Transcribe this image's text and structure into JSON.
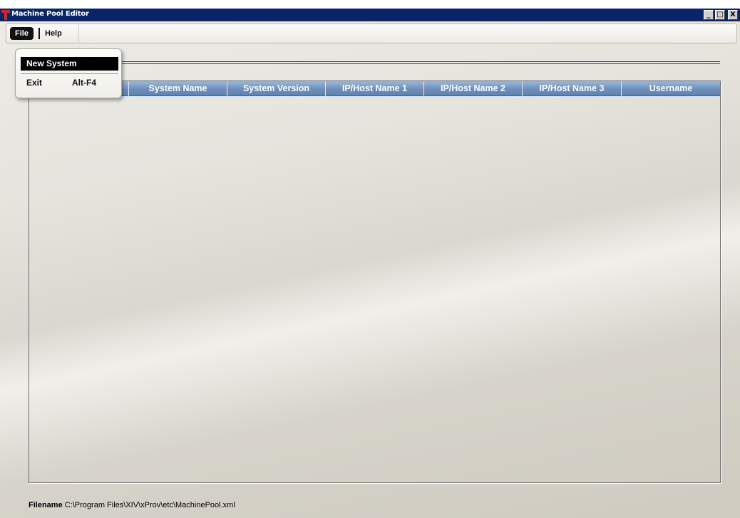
{
  "window": {
    "title": "Machine Pool Editor",
    "icon": "app-t-icon",
    "controls": {
      "minimize": "_",
      "maximize": "□",
      "close": "X"
    }
  },
  "menubar": {
    "file_label": "File",
    "help_label": "Help"
  },
  "file_menu": {
    "items": [
      {
        "label": "New System",
        "shortcut": ""
      },
      {
        "label": "Exit",
        "shortcut": "Alt-F4"
      }
    ]
  },
  "table": {
    "columns": [
      "",
      "System Name",
      "System Version",
      "IP/Host Name 1",
      "IP/Host Name 2",
      "IP/Host Name 3",
      "Username"
    ],
    "rows": []
  },
  "footer": {
    "label": "Filename",
    "value": "C:\\Program Files\\XIV\\xProv\\etc\\MachinePool.xml"
  },
  "colors": {
    "title_bar": "#0a246a",
    "header": "#6d8fbc",
    "menu_active": "#111111"
  }
}
